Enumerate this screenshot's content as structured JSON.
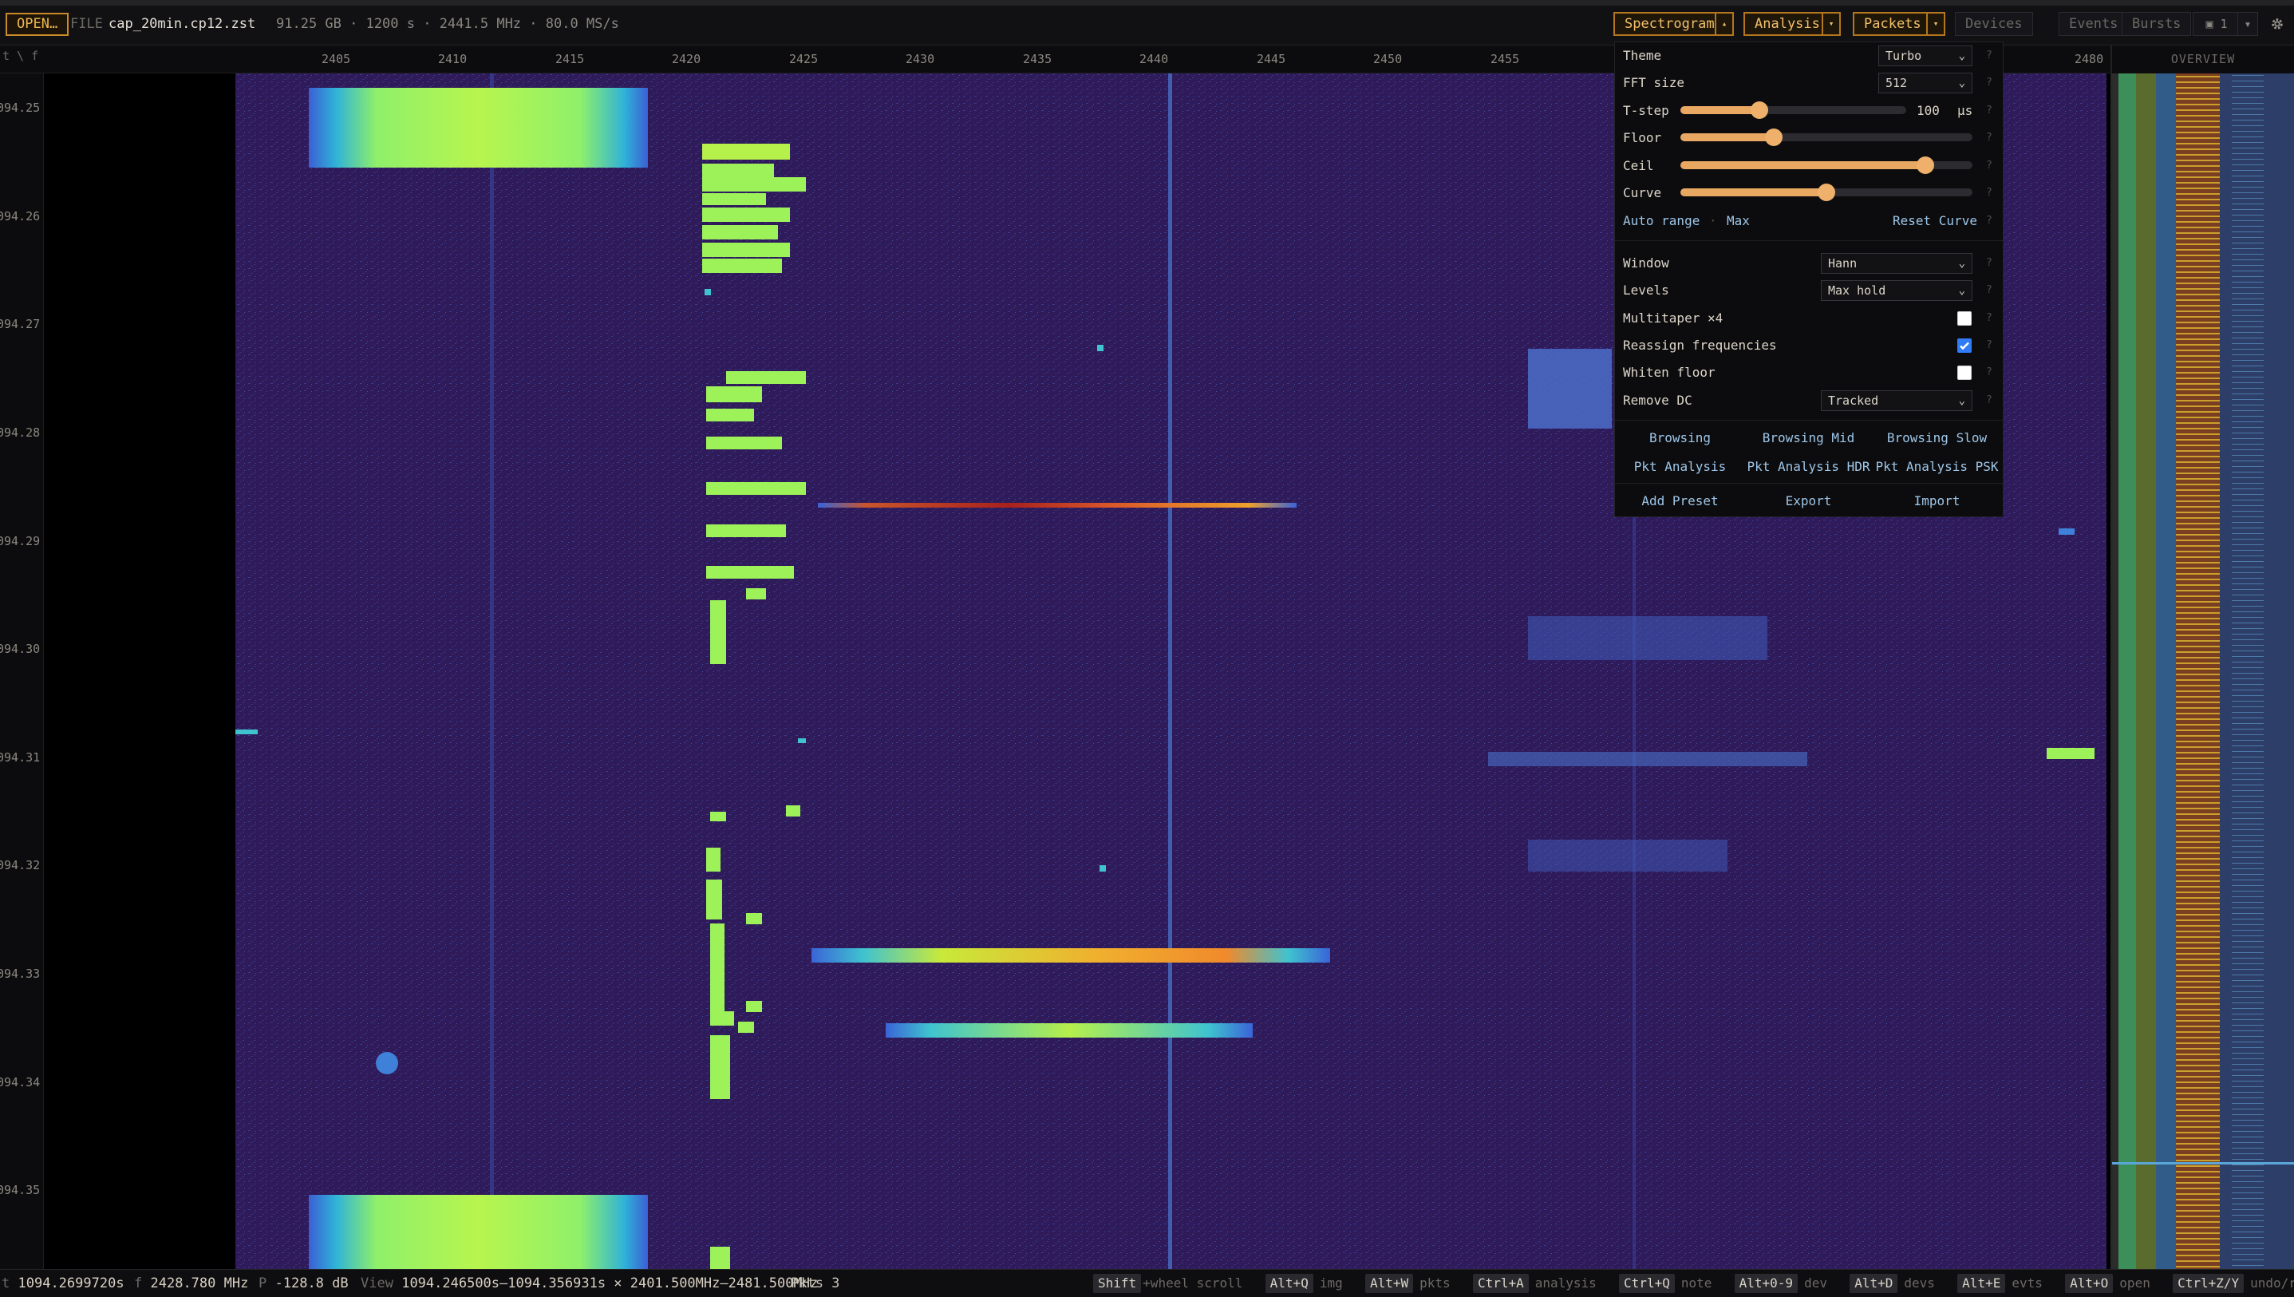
{
  "topbar": {
    "open_label": "OPEN…",
    "file_label": "FILE",
    "file_name": "cap_20min.cp12.zst",
    "file_meta": "91.25 GB · 1200 s · 2441.5 MHz · 80.0 MS/s",
    "spectrogram_label": "Spectrogram",
    "analysis_label": "Analysis",
    "packets_label": "Packets",
    "caret_up": "▴",
    "caret_down": "▾",
    "devices_label": "Devices",
    "events_label": "Events",
    "bursts_label": "Bursts",
    "counter_label": "▣ 1",
    "gear_icon": "gear-icon"
  },
  "ruler": {
    "corner_label": "t \\ f",
    "ticks": [
      "2405",
      "2410",
      "2415",
      "2420",
      "2425",
      "2430",
      "2435",
      "2440",
      "2445",
      "2450",
      "2455",
      "2480"
    ],
    "overview_label": "OVERVIEW"
  },
  "time_axis": {
    "labels": [
      "094.25",
      "094.26",
      "094.27",
      "094.28",
      "094.29",
      "094.30",
      "094.31",
      "094.32",
      "094.33",
      "094.34",
      "094.35"
    ]
  },
  "panel": {
    "theme_label": "Theme",
    "theme_value": "Turbo",
    "fft_label": "FFT size",
    "fft_value": "512",
    "tstep_label": "T-step",
    "tstep_value": "100",
    "tstep_unit": "µs",
    "tstep_level": 0.35,
    "floor_label": "Floor",
    "floor_level": 0.32,
    "ceil_label": "Ceil",
    "ceil_level": 0.84,
    "curve_label": "Curve",
    "curve_level": 0.5,
    "auto_range_label": "Auto range",
    "auto_range_sep": "·",
    "max_label": "Max",
    "reset_curve_label": "Reset Curve",
    "window_label": "Window",
    "window_value": "Hann",
    "levels_label": "Levels",
    "levels_value": "Max hold",
    "multitaper_label": "Multitaper ×4",
    "multitaper_checked": false,
    "reassign_label": "Reassign frequencies",
    "reassign_checked": true,
    "whiten_label": "Whiten floor",
    "whiten_checked": false,
    "remove_dc_label": "Remove DC",
    "remove_dc_value": "Tracked",
    "help_mark": "?",
    "chevron": "⌄",
    "presets": [
      "Browsing",
      "Browsing Mid",
      "Browsing Slow",
      "Pkt Analysis",
      "Pkt Analysis HDR",
      "Pkt Analysis PSK"
    ],
    "add_preset_label": "Add Preset",
    "export_label": "Export",
    "import_label": "Import"
  },
  "status": {
    "t_key": "t",
    "t_val": "1094.2699720s",
    "f_key": "f",
    "f_val": "2428.780 MHz",
    "p_key": "P",
    "p_val": "-128.8 dB",
    "view_key": "View",
    "view_val": "1094.246500s–1094.356931s × 2401.500MHz–2481.500MHz",
    "pkts_label": "Pkts 3",
    "shortcuts": [
      {
        "key": "Shift",
        "desc": "+wheel scroll"
      },
      {
        "key": "Alt+Q",
        "desc": "img"
      },
      {
        "key": "Alt+W",
        "desc": "pkts"
      },
      {
        "key": "Ctrl+A",
        "desc": "analysis"
      },
      {
        "key": "Ctrl+Q",
        "desc": "note"
      },
      {
        "key": "Alt+0-9",
        "desc": "dev"
      },
      {
        "key": "Alt+D",
        "desc": "devs"
      },
      {
        "key": "Alt+E",
        "desc": "evts"
      },
      {
        "key": "Alt+O",
        "desc": "open"
      },
      {
        "key": "Ctrl+Z/Y",
        "desc": "undo/redo"
      }
    ]
  }
}
